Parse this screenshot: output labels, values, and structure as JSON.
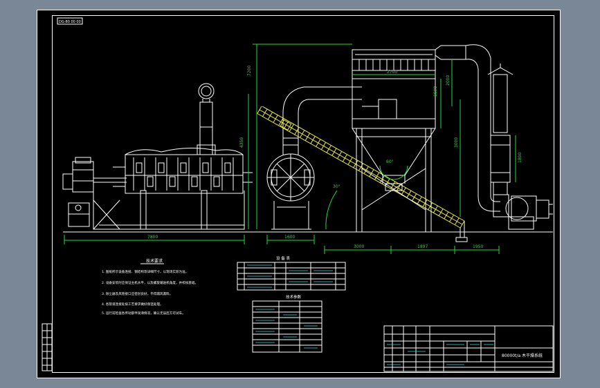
{
  "drawing": {
    "corner_tag": "DG-80 00 00",
    "title_block_name": "80000t/a 木干燥系统",
    "notes_heading": "技术要求",
    "notes": [
      "1. 图纸所示设备连接、钢结构等详细尺寸，以现场实际为准。",
      "2. 设备安装时应保证主机水平，以及螺旋输送机角度，并校核基础。",
      "3. 除尘器及风管接口应密封良好，不得漏风漏料。",
      "4. 各管道连接处按工艺要求做好保温处理。",
      "5. 运行前检查各传动部件润滑情况，确认无误后方可试车。"
    ],
    "table1_heading": "设 备 表",
    "table2_heading": "技术参数",
    "dims": {
      "dryer_len": "7800",
      "furnace_w": "1600",
      "dim_a": "3000",
      "dim_b": "1897",
      "dim_c": "1950",
      "height_main": "7200",
      "height_b": "4350",
      "bag_w": "2700",
      "h_a": "1500",
      "h_b": "2000",
      "h_c": "3000",
      "stack_h": "1800",
      "angle": "30°",
      "cone": "60°"
    }
  },
  "colors": {
    "background": "#7a8796",
    "sheet": "#000000",
    "lines": "#ffffff",
    "dimensions": "#22dd33"
  }
}
